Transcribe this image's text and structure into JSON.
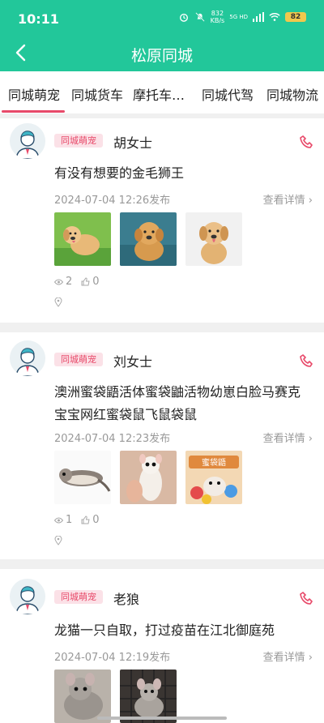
{
  "status": {
    "time": "10:11",
    "speed_value": "832",
    "speed_unit": "KB/s",
    "net": "5G HD",
    "battery": "82"
  },
  "header": {
    "title": "松原同城"
  },
  "tabs": [
    "同城萌宠",
    "同城货车",
    "摩托车…",
    "同城代驾",
    "同城物流"
  ],
  "posts": [
    {
      "category": "同城萌宠",
      "name": "胡女士",
      "text": "有没有想要的金毛狮王",
      "date": "2024-07-04 12:26发布",
      "detail": "查看详情",
      "views": "2",
      "likes": "0",
      "images": [
        "golden-retriever-puppy",
        "golden-retriever-puppy",
        "golden-retriever-puppy"
      ]
    },
    {
      "category": "同城萌宠",
      "name": "刘女士",
      "text": "澳洲蜜袋鼯活体蜜袋鼬活物幼崽白脸马赛克宝宝网红蜜袋鼠飞鼠袋鼠",
      "date": "2024-07-04 12:23发布",
      "detail": "查看详情",
      "views": "1",
      "likes": "0",
      "images": [
        "sugar-glider",
        "sugar-glider",
        "sugar-glider"
      ],
      "image_caption": "蜜袋鼯"
    },
    {
      "category": "同城萌宠",
      "name": "老狼",
      "text": "龙猫一只自取，打过疫苗在江北御庭苑",
      "date": "2024-07-04 12:19发布",
      "detail": "查看详情",
      "images": [
        "chinchilla",
        "chinchilla"
      ]
    }
  ],
  "colors": {
    "primary": "#22c79a",
    "accent": "#e84a6a"
  }
}
